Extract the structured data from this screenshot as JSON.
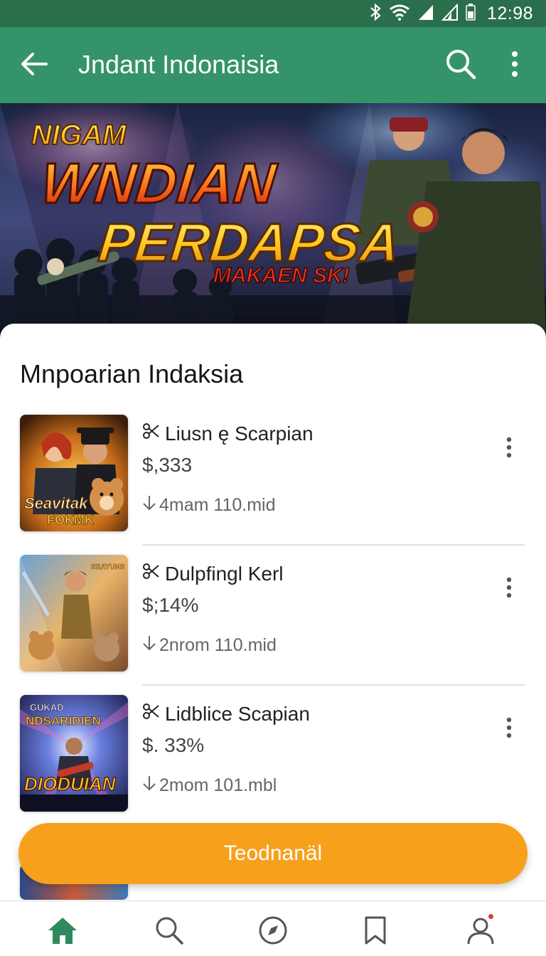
{
  "status_bar": {
    "time": "12:98"
  },
  "app_bar": {
    "title": "Jndant Indonaisia"
  },
  "banner": {
    "line1": "NIGAM",
    "line2": "WNDIAN",
    "line3": "PERDAPSA",
    "line4": "MAKAEN SK!"
  },
  "section": {
    "title": "Mnpoarian Indaksia"
  },
  "items": [
    {
      "title": "Liusn ę Scarpian",
      "price": "$,333",
      "meta": "4mam 110.mid",
      "thumb_text": [
        "Seavitak",
        "FOKMK"
      ]
    },
    {
      "title": "Dulpfingl Kerl",
      "price": "$;14%",
      "meta": "2nrom 110.mid",
      "thumb_text": [
        "SEAYUNS"
      ]
    },
    {
      "title": "Lidblice Scapian",
      "price": "$. 33%",
      "meta": "2mom 101.mbl",
      "thumb_text": [
        "GUKAD",
        "NDSARIDIEN",
        "DIODUIAN"
      ]
    }
  ],
  "cta": {
    "label": "Teodnanäl"
  },
  "bottom_nav": {
    "items": [
      "home-icon",
      "search-icon",
      "compass-icon",
      "bookmark-icon",
      "profile-icon"
    ],
    "active": "home-icon"
  },
  "colors": {
    "app_bar": "#35936a",
    "status_bar": "#2b6e4c",
    "accent": "#f7a01c",
    "nav_active": "#2e8a5e",
    "badge": "#e53935"
  }
}
